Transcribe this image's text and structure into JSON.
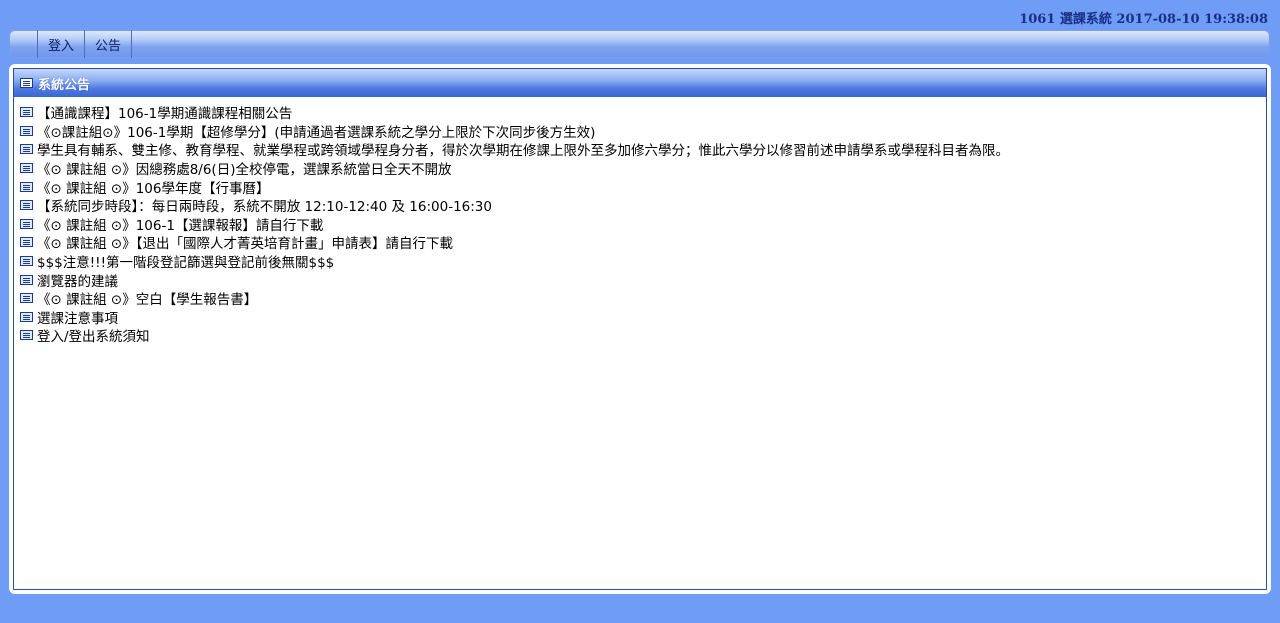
{
  "header": {
    "title": "1061 選課系統 2017-08-10 19:38:08"
  },
  "menu": {
    "items": [
      {
        "label": "登入"
      },
      {
        "label": "公告"
      }
    ]
  },
  "panel": {
    "title": "系統公告",
    "icon": "document-list-icon"
  },
  "announcements": [
    "【通識課程】106-1學期通識課程相關公告",
    "《⊙課註組⊙》106-1學期【超修學分】(申請通過者選課系統之學分上限於下次同步後方生效)",
    "學生具有輔系、雙主修、教育學程、就業學程或跨領域學程身分者，得於次學期在修課上限外至多加修六學分；惟此六學分以修習前述申請學系或學程科目者為限。",
    "《⊙ 課註組 ⊙》因總務處8/6(日)全校停電，選課系統當日全天不開放",
    "《⊙ 課註組 ⊙》106學年度【行事曆】",
    "【系統同步時段】：每日兩時段，系統不開放 12:10-12:40 及 16:00-16:30",
    "《⊙ 課註組 ⊙》106-1【選課報報】請自行下載",
    "《⊙ 課註組 ⊙》【退出「國際人才菁英培育計畫」申請表】請自行下載",
    "$$$注意!!!第一階段登記篩選與登記前後無關$$$",
    "瀏覽器的建議",
    "《⊙ 課註組 ⊙》空白【學生報告書】",
    "選課注意事項",
    "登入/登出系統須知"
  ]
}
